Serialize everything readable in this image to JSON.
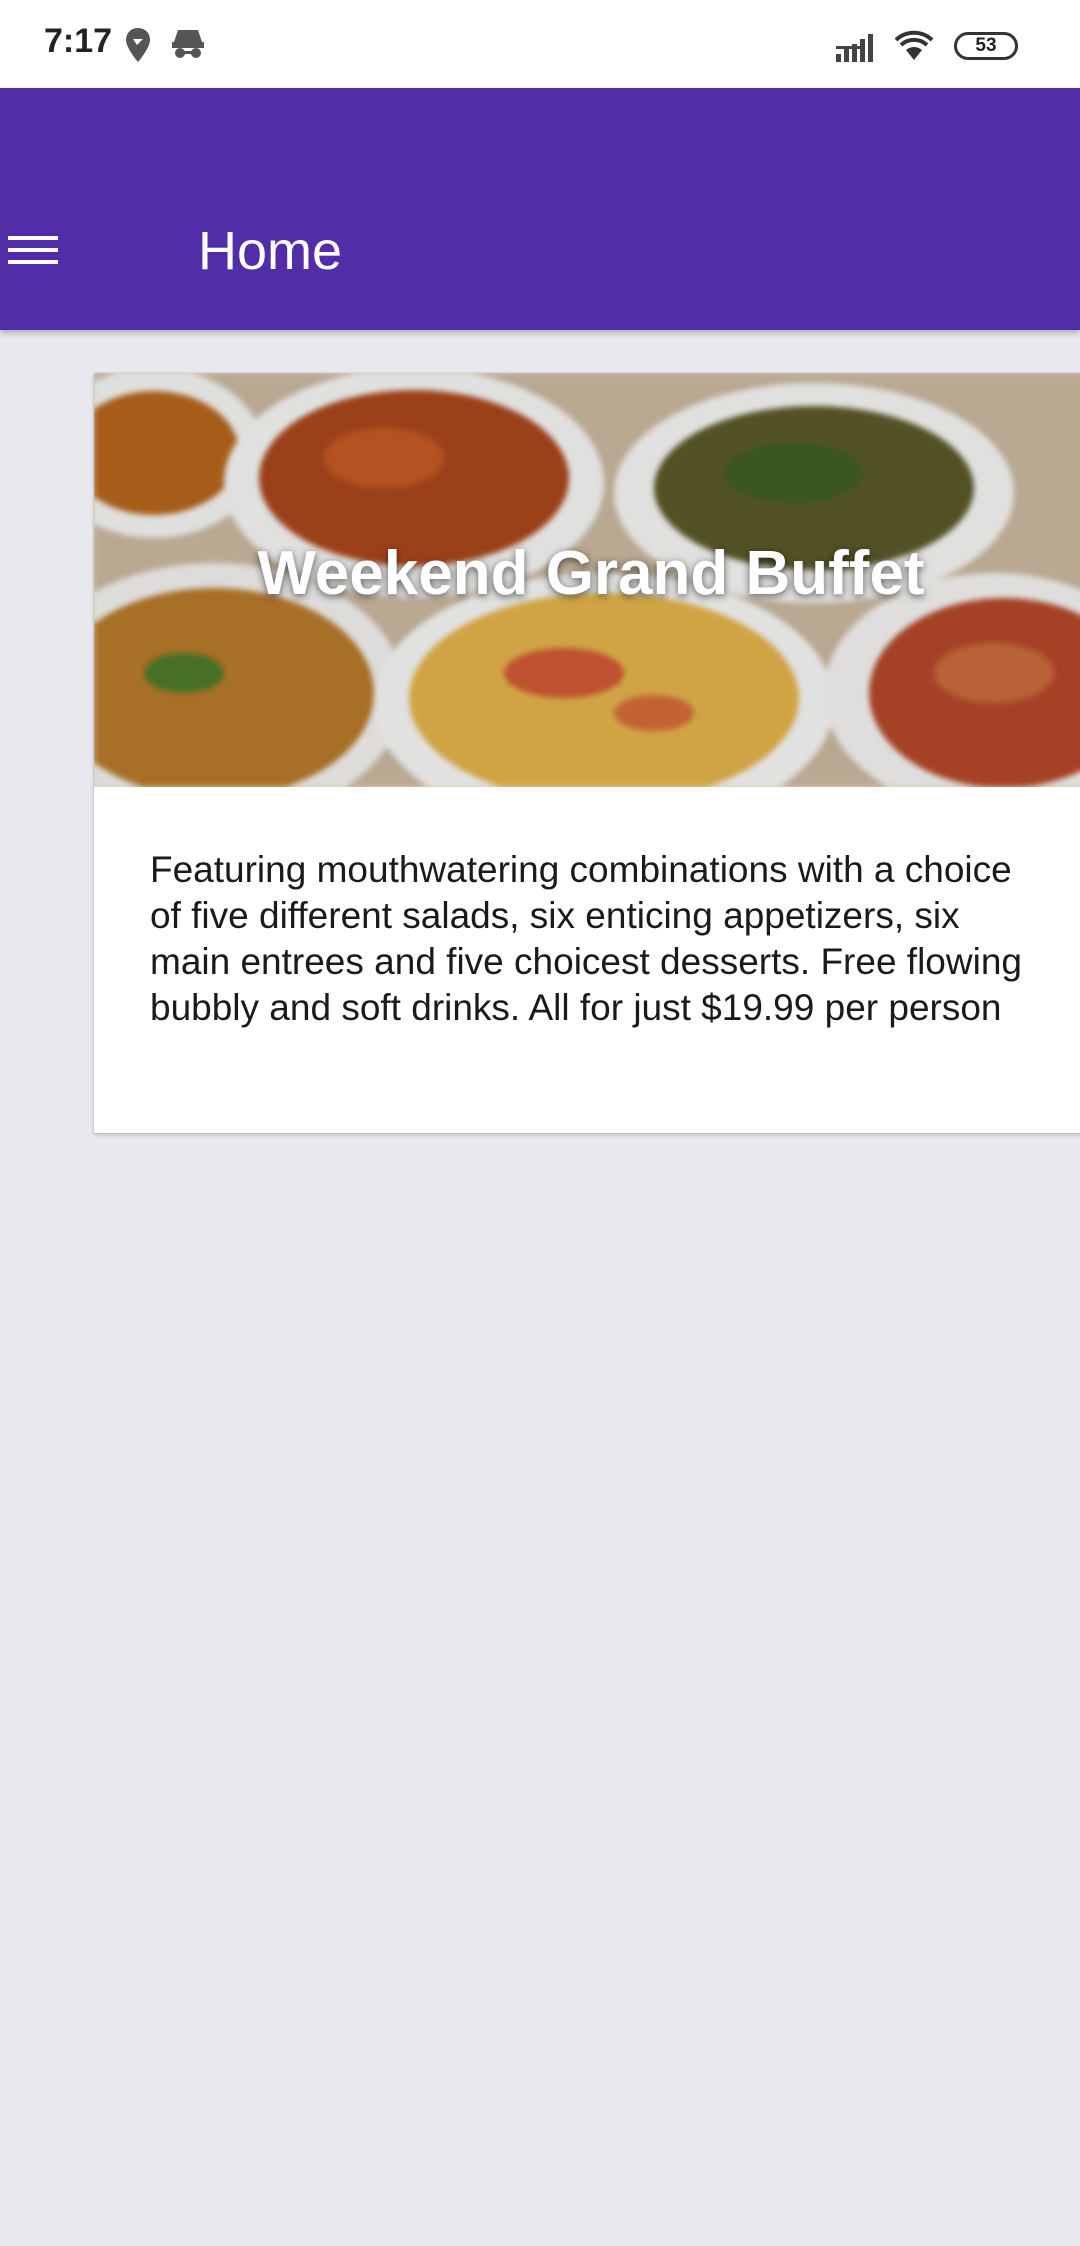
{
  "status_bar": {
    "time": "7:17",
    "battery": "53",
    "icons": [
      "location-icon",
      "incognito-icon",
      "signal-icon",
      "wifi-icon",
      "battery-icon"
    ]
  },
  "app_bar": {
    "title": "Home",
    "menu_icon": "hamburger-menu-icon",
    "background_color": "#512da8"
  },
  "card": {
    "title": "Weekend Grand Buffet",
    "description": "Featuring mouthwatering combinations with a choice of five different salads, six enticing appetizers, six main entrees and five choicest desserts. Free flowing bubbly and soft drinks. All for just $19.99 per person"
  },
  "colors": {
    "page_background": "#e8e8ee",
    "card_background": "#ffffff"
  }
}
